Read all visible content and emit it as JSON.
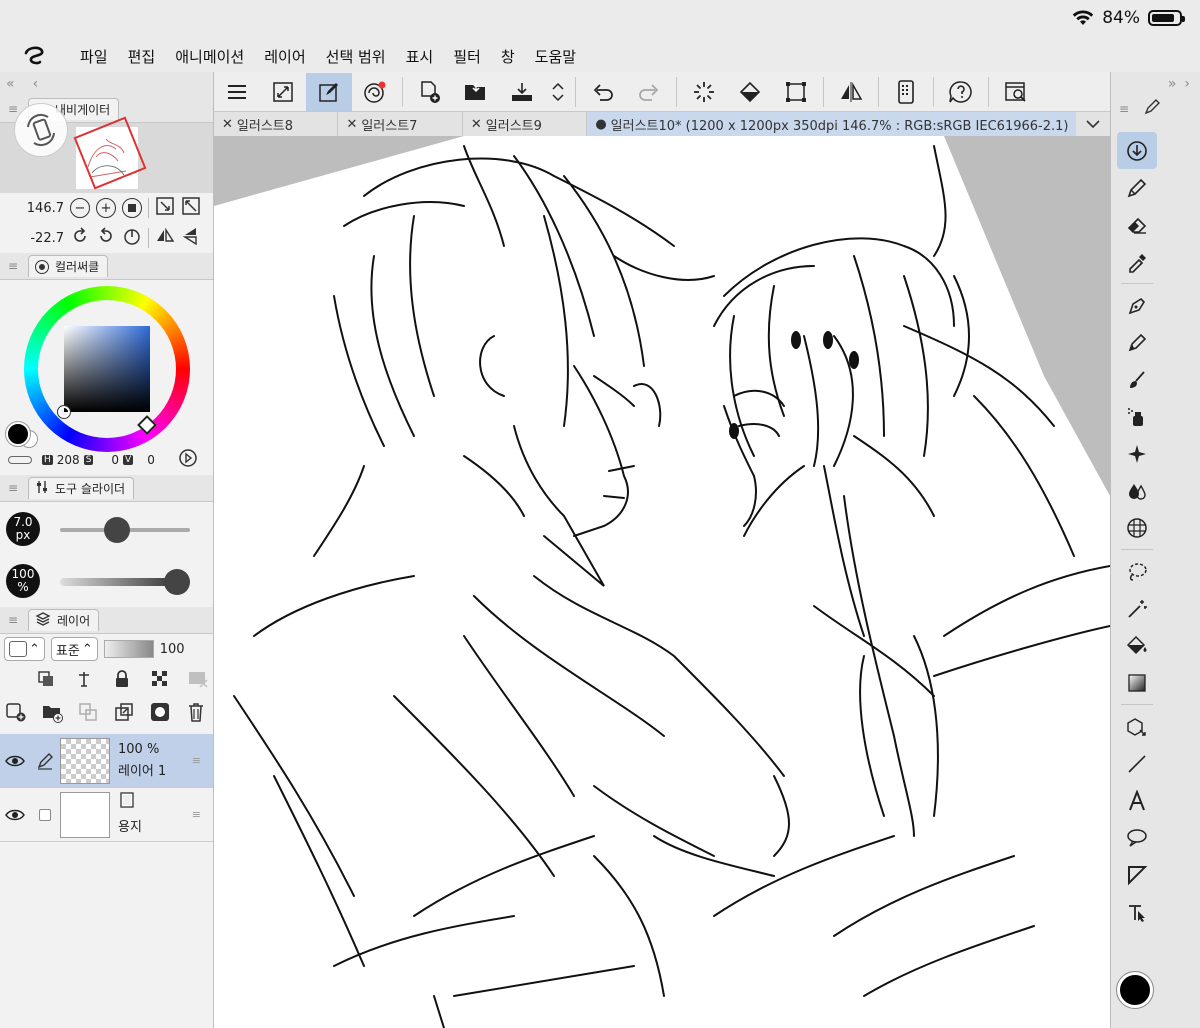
{
  "status": {
    "battery": "84%"
  },
  "menu": [
    "파일",
    "편집",
    "애니메이션",
    "레이어",
    "선택 범위",
    "표시",
    "필터",
    "창",
    "도움말"
  ],
  "navigator": {
    "title": "내비게이터",
    "zoom": "146.7",
    "rotation": "-22.7"
  },
  "color_circle": {
    "title": "컬러써클",
    "h": "208",
    "s": "0",
    "v": "0",
    "h_key": "H",
    "s_key": "S",
    "v_key": "V",
    "main_color": "#000000",
    "accent_color": "#2f6bd8"
  },
  "tool_slider": {
    "title": "도구 슬라이더",
    "size_value": "7.0",
    "size_unit": "px",
    "opacity_value": "100",
    "opacity_unit": "%",
    "size_fraction": 0.42,
    "opacity_fraction": 1.0
  },
  "layers": {
    "title": "레이어",
    "blend_mode": "표준",
    "opacity": "100",
    "items": [
      {
        "opacity": "100 %",
        "name": "레이어 1",
        "selected": true
      },
      {
        "opacity": "",
        "name": "용지",
        "selected": false
      }
    ]
  },
  "tabs": [
    {
      "label": "일러스트8"
    },
    {
      "label": "일러스트7"
    },
    {
      "label": "일러스트9"
    },
    {
      "label": "일러스트10* (1200 x 1200px 350dpi 146.7% : RGB:sRGB IEC61966-2.1)",
      "active": true
    }
  ],
  "selection_color": "#b9cde6"
}
